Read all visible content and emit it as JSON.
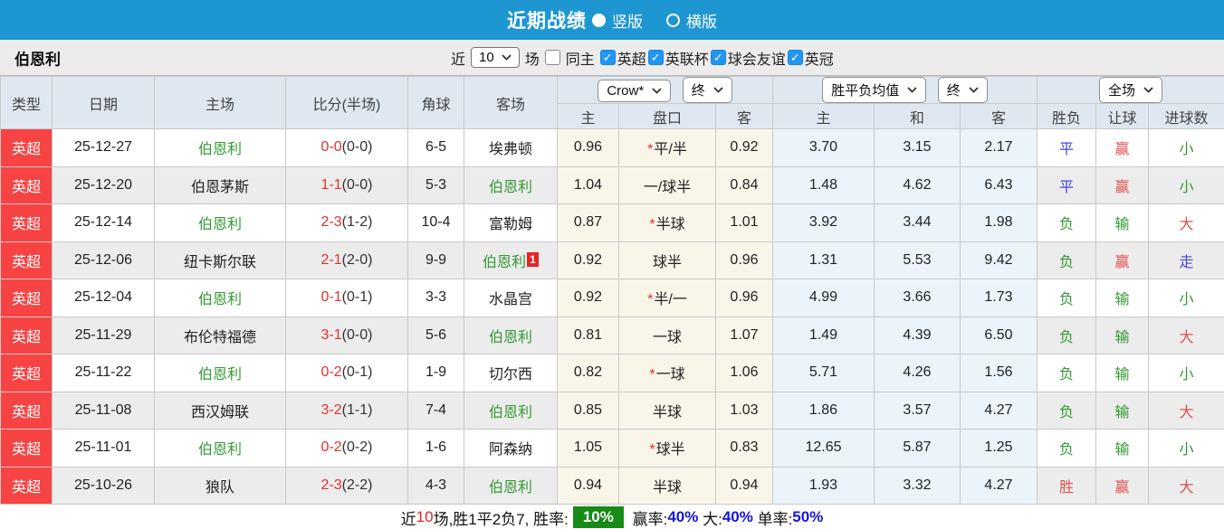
{
  "topbar": {
    "title": "近期战绩",
    "layout_options": [
      {
        "label": "竖版",
        "selected": true
      },
      {
        "label": "横版",
        "selected": false
      }
    ]
  },
  "filterbar": {
    "team": "伯恩利",
    "near_label": "近",
    "count_select_value": "10",
    "games_label": "场",
    "same_home_label": "同主",
    "same_home_checked": false,
    "league_checkboxes": [
      {
        "label": "英超",
        "checked": true
      },
      {
        "label": "英联杯",
        "checked": true
      },
      {
        "label": "球会友谊",
        "checked": true
      },
      {
        "label": "英冠",
        "checked": true
      }
    ]
  },
  "table": {
    "static_headers": [
      "类型",
      "日期",
      "主场",
      "比分(半场)",
      "角球",
      "客场"
    ],
    "group_selects": {
      "odds_company": "Crow*",
      "odds_time": "终",
      "avg_type": "胜平负均值",
      "avg_time": "终",
      "scope": "全场"
    },
    "sub_headers": [
      "主",
      "盘口",
      "客",
      "主",
      "和",
      "客",
      "胜负",
      "让球",
      "进球数"
    ],
    "rows": [
      {
        "league": "英超",
        "date": "25-12-27",
        "home": {
          "name": "伯恩利",
          "green": true
        },
        "score_ft": "0-0",
        "score_ht": "(0-0)",
        "corners": "6-5",
        "away": {
          "name": "埃弗顿",
          "green": false,
          "red_card": ""
        },
        "odds_home": "0.96",
        "handicap": {
          "star": true,
          "text": "平/半"
        },
        "odds_away": "0.92",
        "avg": [
          "3.70",
          "3.15",
          "2.17"
        ],
        "avg_hot": -1,
        "results": [
          {
            "t": "平",
            "c": "blue"
          },
          {
            "t": "赢",
            "c": "red"
          },
          {
            "t": "小",
            "c": "green"
          }
        ]
      },
      {
        "league": "英超",
        "date": "25-12-20",
        "home": {
          "name": "伯恩茅斯",
          "green": false
        },
        "score_ft": "1-1",
        "score_ht": "(0-0)",
        "corners": "5-3",
        "away": {
          "name": "伯恩利",
          "green": true,
          "red_card": ""
        },
        "odds_home": "1.04",
        "handicap": {
          "star": false,
          "text": "一/球半"
        },
        "odds_away": "0.84",
        "avg": [
          "1.48",
          "4.62",
          "6.43"
        ],
        "avg_hot": -1,
        "results": [
          {
            "t": "平",
            "c": "blue"
          },
          {
            "t": "赢",
            "c": "red"
          },
          {
            "t": "小",
            "c": "green"
          }
        ]
      },
      {
        "league": "英超",
        "date": "25-12-14",
        "home": {
          "name": "伯恩利",
          "green": true
        },
        "score_ft": "2-3",
        "score_ht": "(1-2)",
        "corners": "10-4",
        "away": {
          "name": "富勒姆",
          "green": false,
          "red_card": ""
        },
        "odds_home": "0.87",
        "handicap": {
          "star": true,
          "text": "半球"
        },
        "odds_away": "1.01",
        "avg": [
          "3.92",
          "3.44",
          "1.98"
        ],
        "avg_hot": -1,
        "results": [
          {
            "t": "负",
            "c": "green"
          },
          {
            "t": "输",
            "c": "green"
          },
          {
            "t": "大",
            "c": "red"
          }
        ]
      },
      {
        "league": "英超",
        "date": "25-12-06",
        "home": {
          "name": "纽卡斯尔联",
          "green": false
        },
        "score_ft": "2-1",
        "score_ht": "(2-0)",
        "corners": "9-9",
        "away": {
          "name": "伯恩利",
          "green": true,
          "red_card": "1"
        },
        "odds_home": "0.92",
        "handicap": {
          "star": false,
          "text": "球半"
        },
        "odds_away": "0.96",
        "avg": [
          "1.31",
          "5.53",
          "9.42"
        ],
        "avg_hot": -1,
        "results": [
          {
            "t": "负",
            "c": "green"
          },
          {
            "t": "赢",
            "c": "red"
          },
          {
            "t": "走",
            "c": "blue"
          }
        ]
      },
      {
        "league": "英超",
        "date": "25-12-04",
        "home": {
          "name": "伯恩利",
          "green": true
        },
        "score_ft": "0-1",
        "score_ht": "(0-1)",
        "corners": "3-3",
        "away": {
          "name": "水晶宫",
          "green": false,
          "red_card": ""
        },
        "odds_home": "0.92",
        "handicap": {
          "star": true,
          "text": "半/一"
        },
        "odds_away": "0.96",
        "avg": [
          "4.99",
          "3.66",
          "1.73"
        ],
        "avg_hot": -1,
        "results": [
          {
            "t": "负",
            "c": "green"
          },
          {
            "t": "输",
            "c": "green"
          },
          {
            "t": "小",
            "c": "green"
          }
        ]
      },
      {
        "league": "英超",
        "date": "25-11-29",
        "home": {
          "name": "布伦特福德",
          "green": false
        },
        "score_ft": "3-1",
        "score_ht": "(0-0)",
        "corners": "5-6",
        "away": {
          "name": "伯恩利",
          "green": true,
          "red_card": ""
        },
        "odds_home": "0.81",
        "handicap": {
          "star": false,
          "text": "一球"
        },
        "odds_away": "1.07",
        "avg": [
          "1.49",
          "4.39",
          "6.50"
        ],
        "avg_hot": -1,
        "results": [
          {
            "t": "负",
            "c": "green"
          },
          {
            "t": "输",
            "c": "green"
          },
          {
            "t": "大",
            "c": "red"
          }
        ]
      },
      {
        "league": "英超",
        "date": "25-11-22",
        "home": {
          "name": "伯恩利",
          "green": true
        },
        "score_ft": "0-2",
        "score_ht": "(0-1)",
        "corners": "1-9",
        "away": {
          "name": "切尔西",
          "green": false,
          "red_card": ""
        },
        "odds_home": "0.82",
        "handicap": {
          "star": true,
          "text": "一球"
        },
        "odds_away": "1.06",
        "avg": [
          "5.71",
          "4.26",
          "1.56"
        ],
        "avg_hot": -1,
        "results": [
          {
            "t": "负",
            "c": "green"
          },
          {
            "t": "输",
            "c": "green"
          },
          {
            "t": "小",
            "c": "green"
          }
        ]
      },
      {
        "league": "英超",
        "date": "25-11-08",
        "home": {
          "name": "西汉姆联",
          "green": false
        },
        "score_ft": "3-2",
        "score_ht": "(1-1)",
        "corners": "7-4",
        "away": {
          "name": "伯恩利",
          "green": true,
          "red_card": ""
        },
        "odds_home": "0.85",
        "handicap": {
          "star": false,
          "text": "半球"
        },
        "odds_away": "1.03",
        "avg": [
          "1.86",
          "3.57",
          "4.27"
        ],
        "avg_hot": -1,
        "results": [
          {
            "t": "负",
            "c": "green"
          },
          {
            "t": "输",
            "c": "green"
          },
          {
            "t": "大",
            "c": "red"
          }
        ]
      },
      {
        "league": "英超",
        "date": "25-11-01",
        "home": {
          "name": "伯恩利",
          "green": true
        },
        "score_ft": "0-2",
        "score_ht": "(0-2)",
        "corners": "1-6",
        "away": {
          "name": "阿森纳",
          "green": false,
          "red_card": ""
        },
        "odds_home": "1.05",
        "handicap": {
          "star": true,
          "text": "球半"
        },
        "odds_away": "0.83",
        "avg": [
          "12.65",
          "5.87",
          "1.25"
        ],
        "avg_hot": 1,
        "results": [
          {
            "t": "负",
            "c": "green"
          },
          {
            "t": "输",
            "c": "green"
          },
          {
            "t": "小",
            "c": "green"
          }
        ]
      },
      {
        "league": "英超",
        "date": "25-10-26",
        "home": {
          "name": "狼队",
          "green": false
        },
        "score_ft": "2-3",
        "score_ht": "(2-2)",
        "corners": "4-3",
        "away": {
          "name": "伯恩利",
          "green": true,
          "red_card": ""
        },
        "odds_home": "0.94",
        "handicap": {
          "star": false,
          "text": "半球"
        },
        "odds_away": "0.94",
        "avg": [
          "1.93",
          "3.32",
          "4.27"
        ],
        "avg_hot": -1,
        "results": [
          {
            "t": "胜",
            "c": "red"
          },
          {
            "t": "赢",
            "c": "red"
          },
          {
            "t": "大",
            "c": "red"
          }
        ]
      }
    ]
  },
  "footer": {
    "segments": [
      {
        "t": "近",
        "s": "plain"
      },
      {
        "t": "10",
        "s": "red"
      },
      {
        "t": "场,胜1平2负7, 胜率:",
        "s": "plain"
      },
      {
        "t": "10%",
        "s": "badge"
      },
      {
        "t": " 赢率:",
        "s": "plain"
      },
      {
        "t": "40%",
        "s": "blue"
      },
      {
        "t": " 大:",
        "s": "plain"
      },
      {
        "t": "40%",
        "s": "blue"
      },
      {
        "t": " 单率:",
        "s": "plain"
      },
      {
        "t": "50%",
        "s": "blue"
      }
    ]
  }
}
